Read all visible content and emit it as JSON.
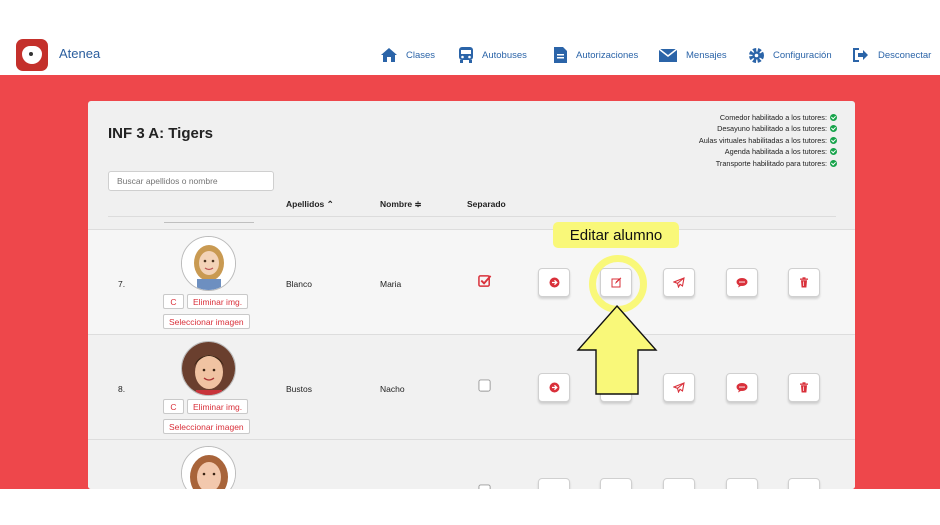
{
  "app": {
    "name": "Atenea"
  },
  "nav": [
    {
      "label": "Clases",
      "icon": "home-icon"
    },
    {
      "label": "Autobuses",
      "icon": "bus-icon"
    },
    {
      "label": "Autorizaciones",
      "icon": "document-icon"
    },
    {
      "label": "Mensajes",
      "icon": "envelope-icon"
    },
    {
      "label": "Configuración",
      "icon": "gear-icon"
    },
    {
      "label": "Desconectar",
      "icon": "logout-icon"
    }
  ],
  "class": {
    "title": "INF 3 A: Tigers"
  },
  "status": [
    "Comedor habilitado a los tutores:",
    "Desayuno habilitado a los tutores:",
    "Aulas virtuales habilitadas a los tutores:",
    "Agenda habilitada a los tutores:",
    "Transporte habilitado para tutores:"
  ],
  "search": {
    "placeholder": "Buscar apellidos o nombre"
  },
  "columns": {
    "apellidos": "Apellidos ⌃",
    "nombre": "Nombre ≑",
    "separado": "Separado"
  },
  "image_buttons": {
    "refresh": "C",
    "delete": "Eliminar img.",
    "select": "Seleccionar imagen"
  },
  "students": [
    {
      "num": "7.",
      "apellidos": "Blanco",
      "nombre": "Maria",
      "separado": true
    },
    {
      "num": "8.",
      "apellidos": "Bustos",
      "nombre": "Nacho",
      "separado": false
    },
    {
      "num": "",
      "apellidos": "",
      "nombre": "",
      "separado": false
    }
  ],
  "tooltip": {
    "label": "Editar alumno"
  },
  "colors": {
    "accent_red": "#ee474b",
    "button_red": "#d9303a",
    "highlight": "#f9f879",
    "nav_blue": "#2b64a8"
  }
}
